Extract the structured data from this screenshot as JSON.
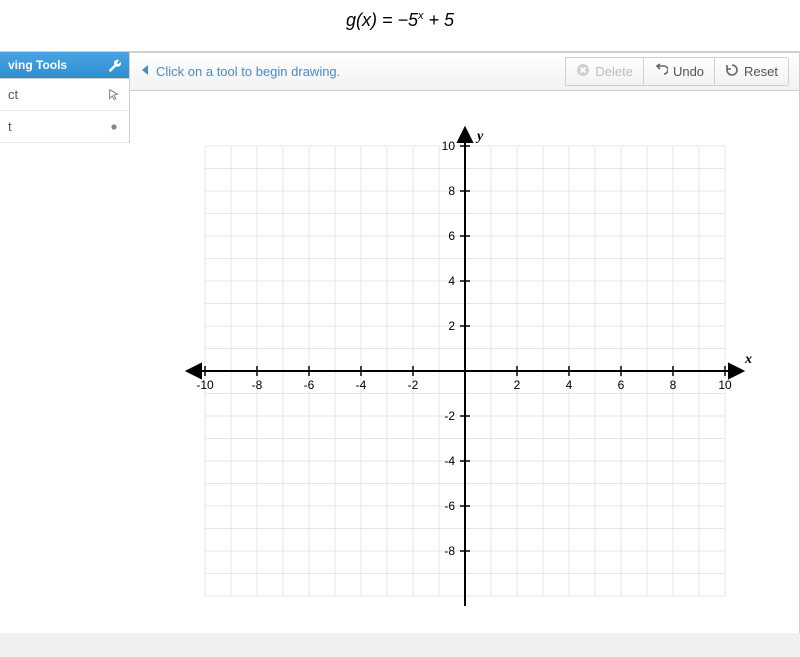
{
  "equation": {
    "fn": "g(x)",
    "eq": " = −5",
    "sup": "x",
    "rest": " + 5"
  },
  "sidebar": {
    "title": "ving Tools",
    "items": [
      {
        "label": "ct"
      },
      {
        "label": "t"
      }
    ]
  },
  "toolbar": {
    "prompt": "Click on a tool to begin drawing.",
    "delete_label": "Delete",
    "undo_label": "Undo",
    "reset_label": "Reset"
  },
  "chart_data": {
    "type": "scatter",
    "title": "",
    "xlabel": "x",
    "ylabel": "y",
    "xlim": [
      -10,
      10
    ],
    "ylim": [
      -10,
      10
    ],
    "xticks": [
      -10,
      -8,
      -6,
      -4,
      -2,
      2,
      4,
      6,
      8,
      10
    ],
    "yticks": [
      -8,
      -6,
      -4,
      -2,
      2,
      4,
      6,
      8,
      10
    ],
    "grid": true,
    "series": []
  }
}
